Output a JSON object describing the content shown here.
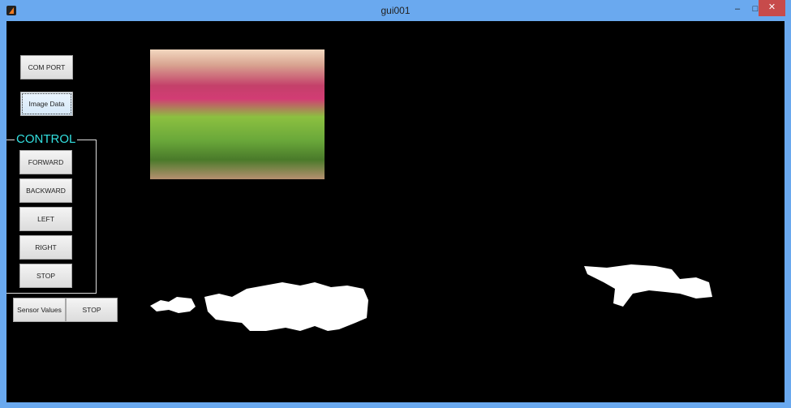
{
  "window": {
    "title": "gui001",
    "minimize": "‒",
    "maximize": "□",
    "close": "✕"
  },
  "buttons": {
    "com_port": "COM PORT",
    "image_data": "Image Data",
    "sensor_values": "Sensor Values",
    "stop_sensor": "STOP"
  },
  "control": {
    "title": "CONTROL",
    "forward": "FORWARD",
    "backward": "BACKWARD",
    "left": "LEFT",
    "right": "RIGHT",
    "stop": "STOP"
  }
}
